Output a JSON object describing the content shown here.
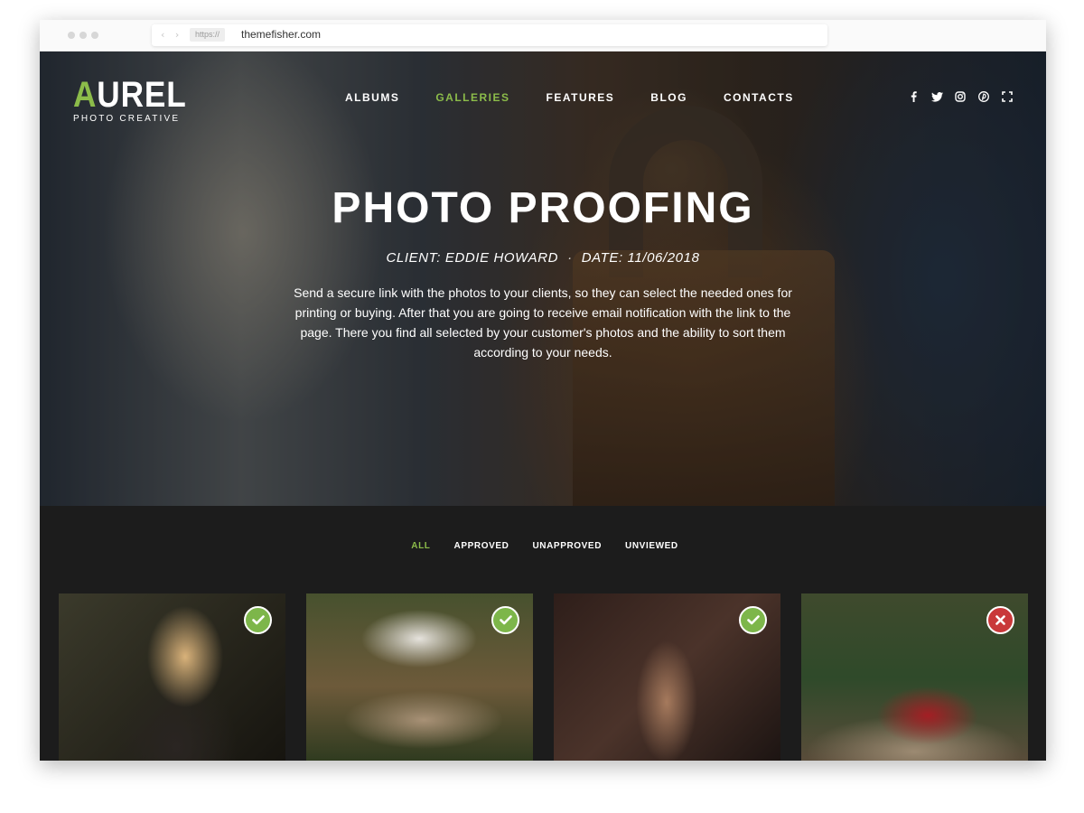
{
  "browser": {
    "protocol": "https://",
    "url": "themefisher.com"
  },
  "header": {
    "logo_first": "A",
    "logo_rest": "UREL",
    "logo_sub": "PHOTO CREATIVE",
    "menu": [
      {
        "label": "ALBUMS",
        "active": false
      },
      {
        "label": "GALLERIES",
        "active": true
      },
      {
        "label": "FEATURES",
        "active": false
      },
      {
        "label": "BLOG",
        "active": false
      },
      {
        "label": "CONTACTS",
        "active": false
      }
    ],
    "social_icons": [
      "facebook-icon",
      "twitter-icon",
      "instagram-icon",
      "pinterest-icon",
      "fullscreen-icon"
    ]
  },
  "hero": {
    "title": "PHOTO PROOFING",
    "client": "CLIENT: EDDIE HOWARD",
    "date": "DATE: 11/06/2018",
    "separator": "·",
    "description": "Send a secure link with the photos to your clients, so they can select the needed ones for printing or buying. After that you are going to receive email notification with the link to the page. There you find all selected by your customer's photos and the ability to sort them according to your needs."
  },
  "gallery": {
    "filters": [
      {
        "label": "ALL",
        "active": true
      },
      {
        "label": "APPROVED",
        "active": false
      },
      {
        "label": "UNAPPROVED",
        "active": false
      },
      {
        "label": "UNVIEWED",
        "active": false
      }
    ],
    "photos": [
      {
        "status": "approved"
      },
      {
        "status": "approved"
      },
      {
        "status": "approved"
      },
      {
        "status": "rejected"
      }
    ]
  },
  "colors": {
    "accent": "#8cbc4a",
    "approved": "#7db64a",
    "rejected": "#c9383a",
    "section_bg": "#1c1c1c"
  }
}
